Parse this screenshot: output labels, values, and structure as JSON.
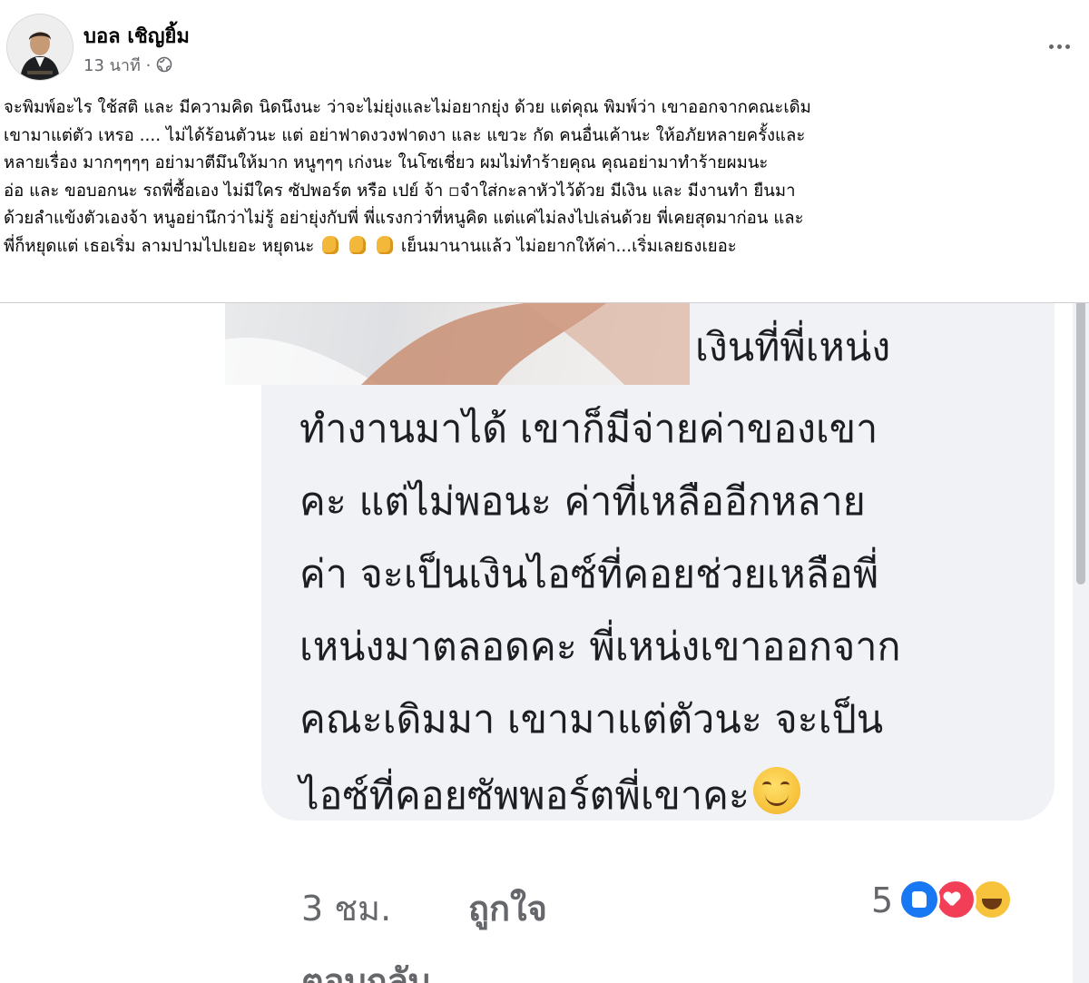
{
  "post": {
    "author": "บอล เชิญยิ้ม",
    "time": "13 นาที ·",
    "privacy_icon": "globe-icon",
    "more_icon": "more-options-icon",
    "caption_lines": [
      "จะพิมพ์อะไร ใช้สติ และ มีความคิด นิดนึงนะ ว่าจะไม่ยุ่งและไม่อยากยุ่ง ด้วย แต่คุณ พิมพ์ว่า เขาออกจากคณะเดิม",
      "เขามาแต่ตัว เหรอ .... ไม่ได้ร้อนตัวนะ แต่ อย่าฟาดงวงฟาดงา และ แขวะ กัด คนอื่นเค้านะ ให้อภัยหลายครั้งและ",
      "หลายเรื่อง มากๆๆๆๆ อย่ามาตีมึนให้มาก หนูๆๆๆ เก่งนะ ในโซเชี่ยว ผมไม่ทำร้ายคุณ คุณอย่ามาทำร้ายผมนะ",
      " อ่อ และ ขอบอกนะ รถพี่ซื้อเอง ไม่มีใคร ซัปพอร์ต หรือ เปย์ จ้า ▫︎จำใส่กะลาหัวไว้ด้วย มีเงิน และ มีงานทำ ยืนมา",
      "ด้วยลำแข้งตัวเองจ้า หนูอย่านึกว่าไม่รู้ อย่ายุ่งกับพี่ พี่แรงกว่าที่หนูคิด แต่แค่ไม่ลงไปเล่นด้วย พี่เคยสุดมาก่อน และ",
      "พี่ก็หยุดแต่ เธอเริ่ม ลามปามไปเยอะ หยุดนะ",
      "เย็นมานานแล้ว ไม่อยากให้ค่า...เริ่มเลยธงเยอะ"
    ]
  },
  "comment": {
    "lines": [
      "เงินที่พี่เหน่ง",
      "ทำงานมาได้ เขาก็มีจ่ายค่าของเขา",
      "คะ แต่ไม่พอนะ ค่าที่เหลืออีกหลาย",
      "ค่า จะเป็นเงินไอซ์ที่คอยช่วยเหลือพี่",
      "เหน่งมาตลอดคะ พี่เหน่งเขาออกจาก",
      "คณะเดิมมา เขามาแต่ตัวนะ จะเป็น",
      "ไอซ์ที่คอยซัพพอร์ตพี่เขาคะ"
    ],
    "time": "3 ชม.",
    "like_label": "ถูกใจ",
    "reply_label": "ตอบกลับ",
    "reaction_count": "5",
    "reactions": [
      "like-icon",
      "love-icon",
      "haha-icon"
    ]
  },
  "colors": {
    "bubble": "#f0f2f5",
    "secondary_text": "#65676b",
    "like_blue": "#1877f2",
    "love_red": "#f33e58",
    "haha_yellow": "#f7c23c"
  }
}
